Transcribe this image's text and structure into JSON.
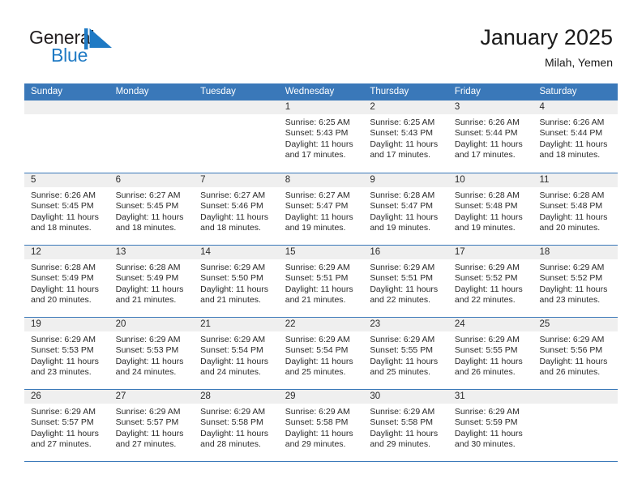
{
  "brand": {
    "name_top": "General",
    "name_bottom": "Blue",
    "mark": "triangle-logo",
    "color_dark": "#231f20",
    "color_blue": "#1f7ac4"
  },
  "header": {
    "title": "January 2025",
    "subtitle": "Milah, Yemen"
  },
  "theme": {
    "accent": "#3a78b9",
    "day_band": "#efefef",
    "text": "#2a2a2a"
  },
  "calendar": {
    "weekdays": [
      "Sunday",
      "Monday",
      "Tuesday",
      "Wednesday",
      "Thursday",
      "Friday",
      "Saturday"
    ],
    "weeks": [
      [
        {
          "day": "",
          "empty": true
        },
        {
          "day": "",
          "empty": true
        },
        {
          "day": "",
          "empty": true
        },
        {
          "day": "1",
          "sunrise": "Sunrise: 6:25 AM",
          "sunset": "Sunset: 5:43 PM",
          "daylight1": "Daylight: 11 hours",
          "daylight2": "and 17 minutes."
        },
        {
          "day": "2",
          "sunrise": "Sunrise: 6:25 AM",
          "sunset": "Sunset: 5:43 PM",
          "daylight1": "Daylight: 11 hours",
          "daylight2": "and 17 minutes."
        },
        {
          "day": "3",
          "sunrise": "Sunrise: 6:26 AM",
          "sunset": "Sunset: 5:44 PM",
          "daylight1": "Daylight: 11 hours",
          "daylight2": "and 17 minutes."
        },
        {
          "day": "4",
          "sunrise": "Sunrise: 6:26 AM",
          "sunset": "Sunset: 5:44 PM",
          "daylight1": "Daylight: 11 hours",
          "daylight2": "and 18 minutes."
        }
      ],
      [
        {
          "day": "5",
          "sunrise": "Sunrise: 6:26 AM",
          "sunset": "Sunset: 5:45 PM",
          "daylight1": "Daylight: 11 hours",
          "daylight2": "and 18 minutes."
        },
        {
          "day": "6",
          "sunrise": "Sunrise: 6:27 AM",
          "sunset": "Sunset: 5:45 PM",
          "daylight1": "Daylight: 11 hours",
          "daylight2": "and 18 minutes."
        },
        {
          "day": "7",
          "sunrise": "Sunrise: 6:27 AM",
          "sunset": "Sunset: 5:46 PM",
          "daylight1": "Daylight: 11 hours",
          "daylight2": "and 18 minutes."
        },
        {
          "day": "8",
          "sunrise": "Sunrise: 6:27 AM",
          "sunset": "Sunset: 5:47 PM",
          "daylight1": "Daylight: 11 hours",
          "daylight2": "and 19 minutes."
        },
        {
          "day": "9",
          "sunrise": "Sunrise: 6:28 AM",
          "sunset": "Sunset: 5:47 PM",
          "daylight1": "Daylight: 11 hours",
          "daylight2": "and 19 minutes."
        },
        {
          "day": "10",
          "sunrise": "Sunrise: 6:28 AM",
          "sunset": "Sunset: 5:48 PM",
          "daylight1": "Daylight: 11 hours",
          "daylight2": "and 19 minutes."
        },
        {
          "day": "11",
          "sunrise": "Sunrise: 6:28 AM",
          "sunset": "Sunset: 5:48 PM",
          "daylight1": "Daylight: 11 hours",
          "daylight2": "and 20 minutes."
        }
      ],
      [
        {
          "day": "12",
          "sunrise": "Sunrise: 6:28 AM",
          "sunset": "Sunset: 5:49 PM",
          "daylight1": "Daylight: 11 hours",
          "daylight2": "and 20 minutes."
        },
        {
          "day": "13",
          "sunrise": "Sunrise: 6:28 AM",
          "sunset": "Sunset: 5:49 PM",
          "daylight1": "Daylight: 11 hours",
          "daylight2": "and 21 minutes."
        },
        {
          "day": "14",
          "sunrise": "Sunrise: 6:29 AM",
          "sunset": "Sunset: 5:50 PM",
          "daylight1": "Daylight: 11 hours",
          "daylight2": "and 21 minutes."
        },
        {
          "day": "15",
          "sunrise": "Sunrise: 6:29 AM",
          "sunset": "Sunset: 5:51 PM",
          "daylight1": "Daylight: 11 hours",
          "daylight2": "and 21 minutes."
        },
        {
          "day": "16",
          "sunrise": "Sunrise: 6:29 AM",
          "sunset": "Sunset: 5:51 PM",
          "daylight1": "Daylight: 11 hours",
          "daylight2": "and 22 minutes."
        },
        {
          "day": "17",
          "sunrise": "Sunrise: 6:29 AM",
          "sunset": "Sunset: 5:52 PM",
          "daylight1": "Daylight: 11 hours",
          "daylight2": "and 22 minutes."
        },
        {
          "day": "18",
          "sunrise": "Sunrise: 6:29 AM",
          "sunset": "Sunset: 5:52 PM",
          "daylight1": "Daylight: 11 hours",
          "daylight2": "and 23 minutes."
        }
      ],
      [
        {
          "day": "19",
          "sunrise": "Sunrise: 6:29 AM",
          "sunset": "Sunset: 5:53 PM",
          "daylight1": "Daylight: 11 hours",
          "daylight2": "and 23 minutes."
        },
        {
          "day": "20",
          "sunrise": "Sunrise: 6:29 AM",
          "sunset": "Sunset: 5:53 PM",
          "daylight1": "Daylight: 11 hours",
          "daylight2": "and 24 minutes."
        },
        {
          "day": "21",
          "sunrise": "Sunrise: 6:29 AM",
          "sunset": "Sunset: 5:54 PM",
          "daylight1": "Daylight: 11 hours",
          "daylight2": "and 24 minutes."
        },
        {
          "day": "22",
          "sunrise": "Sunrise: 6:29 AM",
          "sunset": "Sunset: 5:54 PM",
          "daylight1": "Daylight: 11 hours",
          "daylight2": "and 25 minutes."
        },
        {
          "day": "23",
          "sunrise": "Sunrise: 6:29 AM",
          "sunset": "Sunset: 5:55 PM",
          "daylight1": "Daylight: 11 hours",
          "daylight2": "and 25 minutes."
        },
        {
          "day": "24",
          "sunrise": "Sunrise: 6:29 AM",
          "sunset": "Sunset: 5:55 PM",
          "daylight1": "Daylight: 11 hours",
          "daylight2": "and 26 minutes."
        },
        {
          "day": "25",
          "sunrise": "Sunrise: 6:29 AM",
          "sunset": "Sunset: 5:56 PM",
          "daylight1": "Daylight: 11 hours",
          "daylight2": "and 26 minutes."
        }
      ],
      [
        {
          "day": "26",
          "sunrise": "Sunrise: 6:29 AM",
          "sunset": "Sunset: 5:57 PM",
          "daylight1": "Daylight: 11 hours",
          "daylight2": "and 27 minutes."
        },
        {
          "day": "27",
          "sunrise": "Sunrise: 6:29 AM",
          "sunset": "Sunset: 5:57 PM",
          "daylight1": "Daylight: 11 hours",
          "daylight2": "and 27 minutes."
        },
        {
          "day": "28",
          "sunrise": "Sunrise: 6:29 AM",
          "sunset": "Sunset: 5:58 PM",
          "daylight1": "Daylight: 11 hours",
          "daylight2": "and 28 minutes."
        },
        {
          "day": "29",
          "sunrise": "Sunrise: 6:29 AM",
          "sunset": "Sunset: 5:58 PM",
          "daylight1": "Daylight: 11 hours",
          "daylight2": "and 29 minutes."
        },
        {
          "day": "30",
          "sunrise": "Sunrise: 6:29 AM",
          "sunset": "Sunset: 5:58 PM",
          "daylight1": "Daylight: 11 hours",
          "daylight2": "and 29 minutes."
        },
        {
          "day": "31",
          "sunrise": "Sunrise: 6:29 AM",
          "sunset": "Sunset: 5:59 PM",
          "daylight1": "Daylight: 11 hours",
          "daylight2": "and 30 minutes."
        },
        {
          "day": "",
          "empty": true
        }
      ]
    ]
  }
}
